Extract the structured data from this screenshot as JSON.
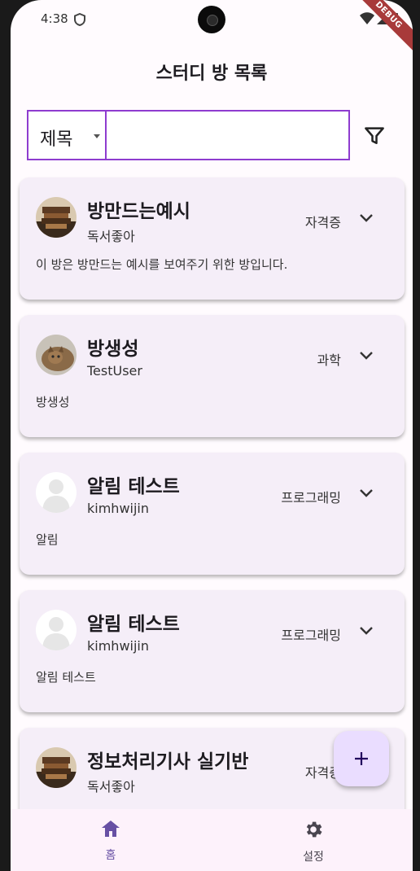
{
  "status_bar": {
    "time": "4:38",
    "debug_label": "DEBUG"
  },
  "app_bar": {
    "title": "스터디 방 목록"
  },
  "search": {
    "field_selected": "제목",
    "query": "",
    "filter_icon": "filter-icon"
  },
  "rooms": [
    {
      "title": "방만드는예시",
      "owner": "독서좋아",
      "category": "자격증",
      "description": "이 방은 방만드는 예시를 보여주기 위한 방입니다.",
      "avatar": "photo-books"
    },
    {
      "title": "방생성",
      "owner": "TestUser",
      "category": "과학",
      "description": "방생성",
      "avatar": "photo-cat"
    },
    {
      "title": "알림 테스트",
      "owner": "kimhwijin",
      "category": "프로그래밍",
      "description": "알림",
      "avatar": "default-person"
    },
    {
      "title": "알림 테스트",
      "owner": "kimhwijin",
      "category": "프로그래밍",
      "description": "알림 테스트",
      "avatar": "default-person"
    },
    {
      "title": "정보처리기사 실기반",
      "owner": "독서좋아",
      "category": "자격증",
      "description": "",
      "avatar": "photo-books"
    }
  ],
  "fab": {
    "icon": "plus-icon"
  },
  "bottom_nav": {
    "items": [
      {
        "label": "홈",
        "icon": "home-icon",
        "active": true
      },
      {
        "label": "설정",
        "icon": "gear-icon",
        "active": false
      }
    ]
  },
  "colors": {
    "accent": "#8e3ccf",
    "card_bg": "#f5eef8",
    "fab_bg": "#eaddff",
    "nav_active": "#6750a4"
  }
}
